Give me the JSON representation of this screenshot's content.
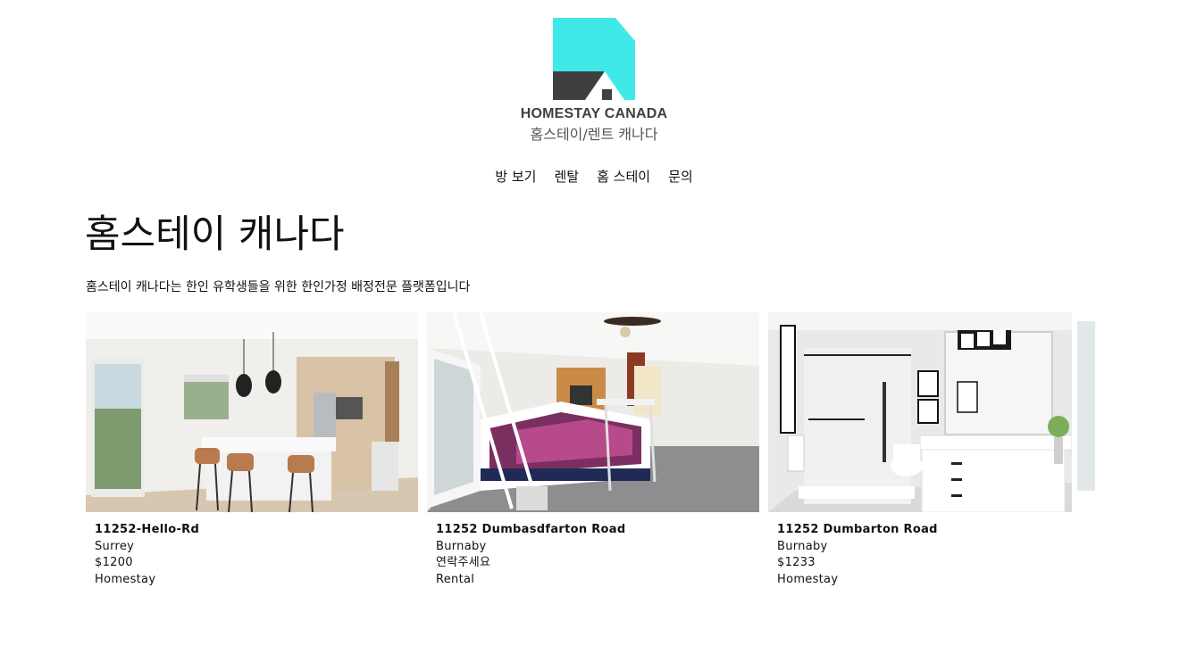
{
  "logo": {
    "brand": "HOMESTAY CANADA",
    "subtitle": "홈스테이/렌트 캐나다",
    "colors": {
      "teal": "#40e9e9",
      "dark": "#3f3f3f"
    }
  },
  "nav": {
    "items": [
      {
        "label": "방 보기"
      },
      {
        "label": "렌탈"
      },
      {
        "label": "홈 스테이"
      },
      {
        "label": "문의"
      }
    ]
  },
  "main": {
    "title": "홈스테이 캐나다",
    "description": "홈스테이 캐나다는 한인 유학생들을 위한 한인가정 배정전문 플랫폼입니다"
  },
  "listings": [
    {
      "address": "11252-Hello-Rd",
      "city": "Surrey",
      "price": "$1200",
      "type": "Homestay",
      "photo": "kitchen"
    },
    {
      "address": "11252 Dumbasdfarton Road",
      "city": "Burnaby",
      "price": "연락주세요",
      "type": "Rental",
      "photo": "bedroom"
    },
    {
      "address": "11252 Dumbarton Road",
      "city": "Burnaby",
      "price": "$1233",
      "type": "Homestay",
      "photo": "bathroom"
    }
  ]
}
